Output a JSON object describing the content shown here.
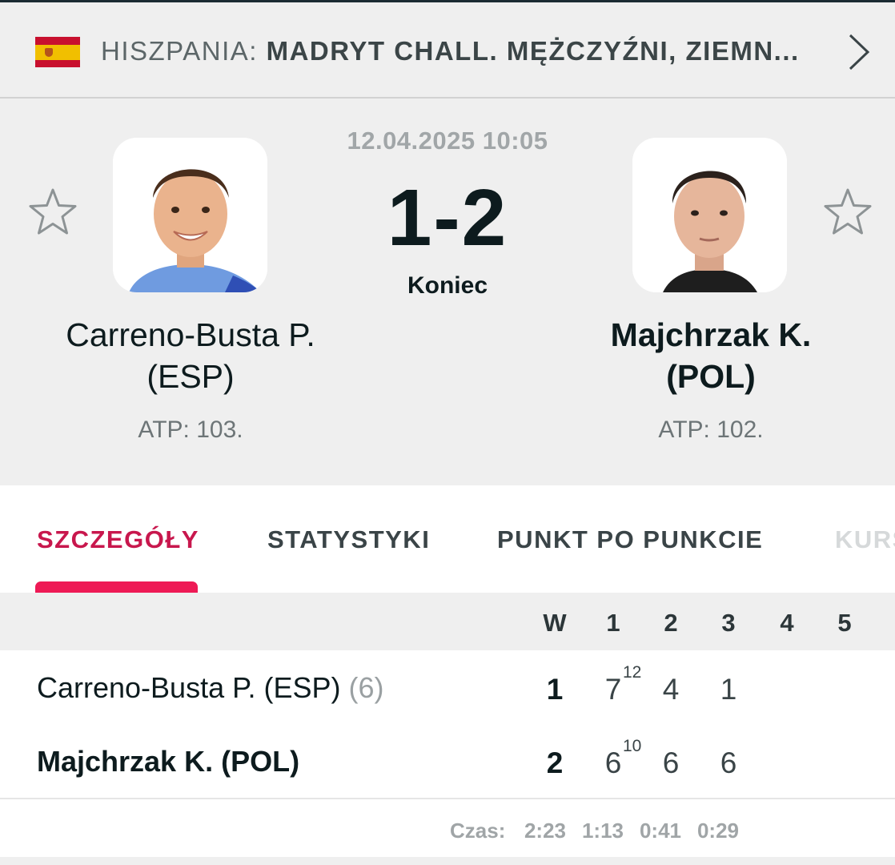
{
  "league": {
    "country": "HISZPANIA:",
    "tournament": "MADRYT CHALL. MĘŻCZYŹNI, ZIEMN...",
    "flag_icon": "spain-flag-icon"
  },
  "match": {
    "datetime": "12.04.2025 10:05",
    "score": "1-2",
    "status": "Koniec",
    "home": {
      "name_line1": "Carreno-Busta P.",
      "name_line2": "(ESP)",
      "rank": "ATP: 103."
    },
    "away": {
      "name_line1": "Majchrzak K.",
      "name_line2": "(POL)",
      "rank": "ATP: 102."
    }
  },
  "tabs": [
    {
      "label": "SZCZEGÓŁY",
      "active": true
    },
    {
      "label": "STATYSTYKI"
    },
    {
      "label": "PUNKT PO PUNKCIE"
    },
    {
      "label": "KURS"
    }
  ],
  "table": {
    "headers": [
      "W",
      "1",
      "2",
      "3",
      "4",
      "5"
    ],
    "rows": [
      {
        "name": "Carreno-Busta P. (ESP)",
        "seed": "(6)",
        "total": "1",
        "sets": [
          "7",
          "4",
          "1"
        ],
        "tiebreak": "12"
      },
      {
        "name": "Majchrzak K. (POL)",
        "seed": "",
        "total": "2",
        "sets": [
          "6",
          "6",
          "6"
        ],
        "tiebreak": "10"
      }
    ],
    "time_label": "Czas:",
    "times": [
      "2:23",
      "1:13",
      "0:41",
      "0:29"
    ]
  },
  "colors": {
    "accent": "#ee1a55",
    "accent_text": "#c8174d",
    "dark": "#0d1b1e"
  }
}
